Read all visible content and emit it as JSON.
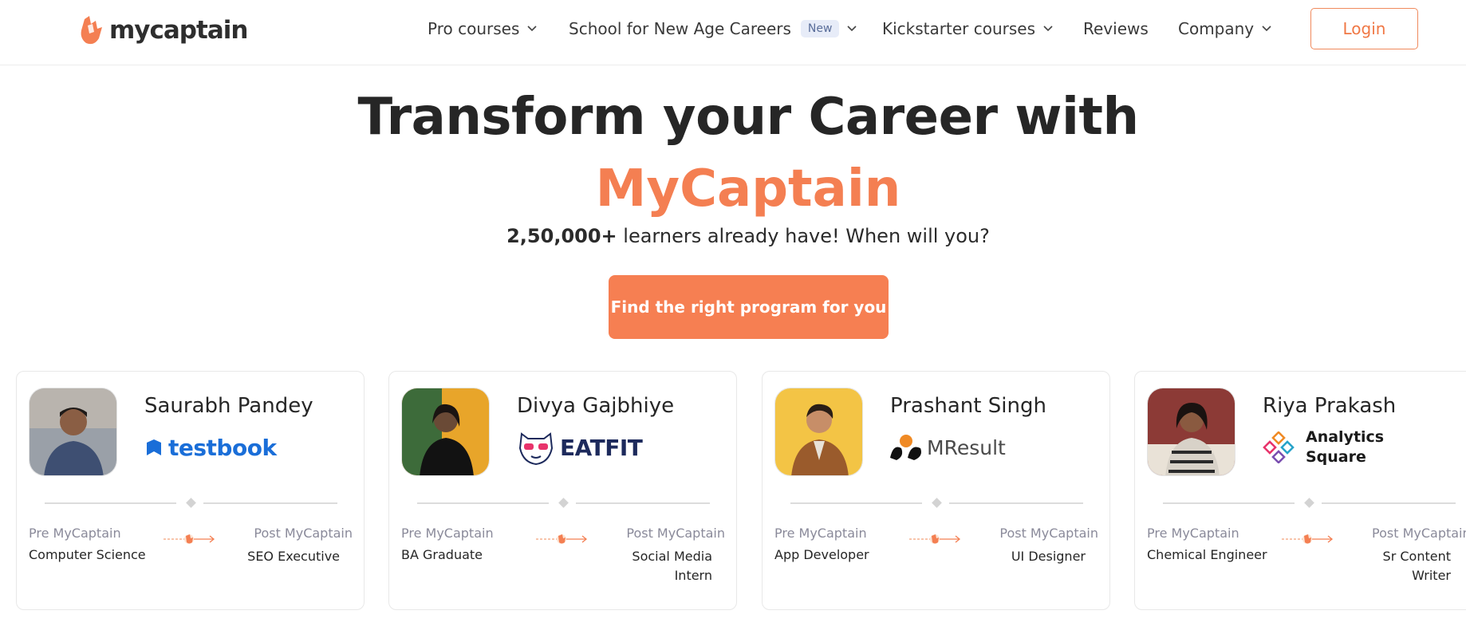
{
  "header": {
    "logo_text": "mycaptain",
    "nav": [
      {
        "label": "Pro courses",
        "has_dropdown": true
      },
      {
        "label": "School for New Age Careers",
        "badge": "New",
        "has_dropdown": true
      },
      {
        "label": "Kickstarter courses",
        "has_dropdown": true
      },
      {
        "label": "Reviews",
        "has_dropdown": false
      },
      {
        "label": "Company",
        "has_dropdown": true
      }
    ],
    "login_label": "Login"
  },
  "hero": {
    "title": "Transform your Career with",
    "brand": "MyCaptain",
    "subtitle_count": "2,50,000+",
    "subtitle_rest": " learners already have! When will you?",
    "cta_label": "Find the right program for you"
  },
  "cards": [
    {
      "name": "Saurabh Pandey",
      "company": "testbook",
      "pre_label": "Pre MyCaptain",
      "pre_value": "Computer Science",
      "post_label": "Post MyCaptain",
      "post_value": "SEO Executive"
    },
    {
      "name": "Divya Gajbhiye",
      "company": "EATFIT",
      "pre_label": "Pre MyCaptain",
      "pre_value": "BA Graduate",
      "post_label": "Post MyCaptain",
      "post_value": "Social Media Intern"
    },
    {
      "name": "Prashant Singh",
      "company": "MResult",
      "pre_label": "Pre MyCaptain",
      "pre_value": "App Developer",
      "post_label": "Post MyCaptain",
      "post_value": "UI Designer"
    },
    {
      "name": "Riya Prakash",
      "company": "Analytics Square",
      "pre_label": "Pre MyCaptain",
      "pre_value": "Chemical Engineer",
      "post_label": "Post MyCaptain",
      "post_value": "Sr Content Writer"
    }
  ],
  "colors": {
    "accent": "#f67f52",
    "text": "#262626",
    "muted": "#8a8a9a",
    "badge_bg": "#e7ecf8"
  }
}
